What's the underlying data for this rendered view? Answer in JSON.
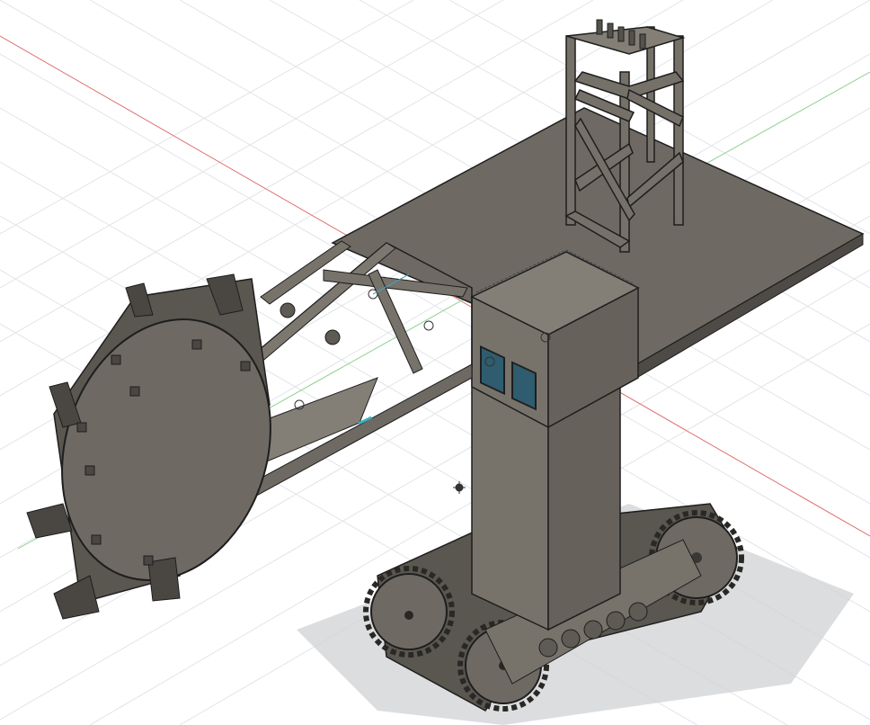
{
  "viewport": {
    "background_color": "#ffffff",
    "grid_color": "#d9dde2",
    "axis_x_color": "#e07070",
    "axis_y_color": "#8fd08f",
    "body_color": "#6e6a63",
    "body_light_color": "#837f77",
    "body_dark_color": "#55524c",
    "edge_color": "#1e1e1e",
    "glass_color": "#2f5c6e",
    "shadow_color": "#c9cbcf",
    "origin_icon": "origin-crosshair-icon",
    "joint_icon": "joint-marker-icon"
  }
}
